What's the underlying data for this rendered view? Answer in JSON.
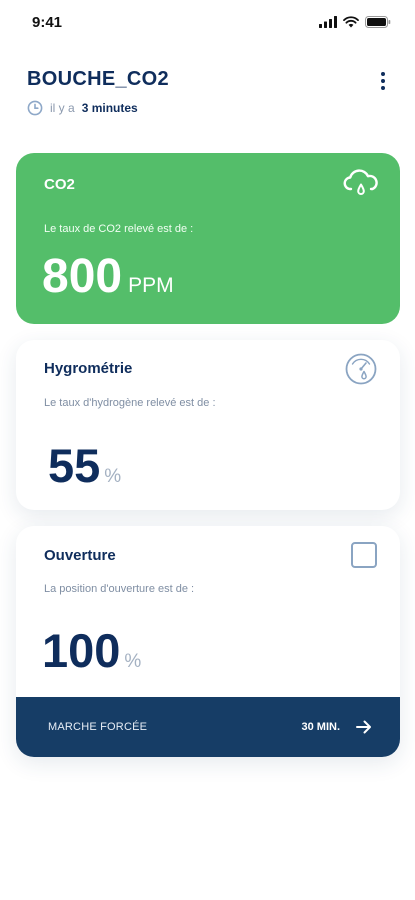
{
  "status_bar": {
    "time": "9:41"
  },
  "header": {
    "title": "BOUCHE_CO2",
    "updated_prefix": "il y a",
    "updated_value": "3 minutes"
  },
  "cards": {
    "co2": {
      "title": "CO2",
      "description": "Le taux de CO2 relevé est de :",
      "value": "800",
      "unit": "PPM",
      "icon": "cloud-drop-icon",
      "color": "#54be6a"
    },
    "hygrometry": {
      "title": "Hygrométrie",
      "description": "Le taux d'hydrogène relevé est de :",
      "value": "55",
      "unit": "%",
      "icon": "gauge-drop-icon"
    },
    "opening": {
      "title": "Ouverture",
      "description": "La position d'ouverture est de :",
      "value": "100",
      "unit": "%",
      "checkbox_checked": false
    }
  },
  "force_bar": {
    "label": "MARCHE FORCÉE",
    "duration": "30 MIN.",
    "color": "#163d66"
  }
}
